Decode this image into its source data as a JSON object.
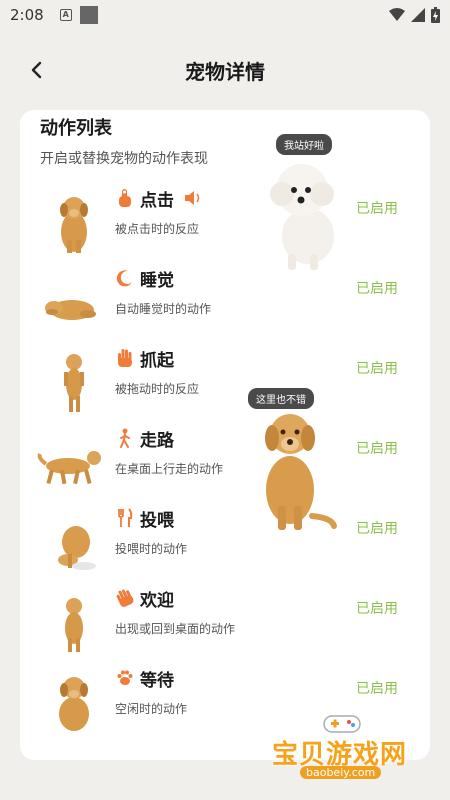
{
  "status_bar": {
    "time": "2:08",
    "a_icon_label": "A"
  },
  "header": {
    "title": "宠物详情"
  },
  "section": {
    "title": "动作列表",
    "subtitle": "开启或替换宠物的动作表现"
  },
  "bubbles": {
    "poodle": "我站好啦",
    "retriever": "这里也不错"
  },
  "actions": [
    {
      "name": "点击",
      "desc": "被点击时的反应",
      "status": "已启用",
      "icon": "tap-hand-icon",
      "has_sound": true
    },
    {
      "name": "睡觉",
      "desc": "自动睡觉时的动作",
      "status": "已启用",
      "icon": "moon-icon"
    },
    {
      "name": "抓起",
      "desc": "被拖动时的反应",
      "status": "已启用",
      "icon": "hand-icon"
    },
    {
      "name": "走路",
      "desc": "在桌面上行走的动作",
      "status": "已启用",
      "icon": "walking-person-icon"
    },
    {
      "name": "投喂",
      "desc": "投喂时的动作",
      "status": "已启用",
      "icon": "fork-knife-icon"
    },
    {
      "name": "欢迎",
      "desc": "出现或回到桌面的动作",
      "status": "已启用",
      "icon": "waving-hand-icon"
    },
    {
      "name": "等待",
      "desc": "空闲时的动作",
      "status": "已启用",
      "icon": "paw-icon"
    }
  ],
  "watermark": {
    "text": "宝贝游戏网",
    "url": "baobeiy.com"
  },
  "colors": {
    "accent": "#f07c3c",
    "enabled": "#8bbf4a",
    "background": "#f1efec"
  }
}
